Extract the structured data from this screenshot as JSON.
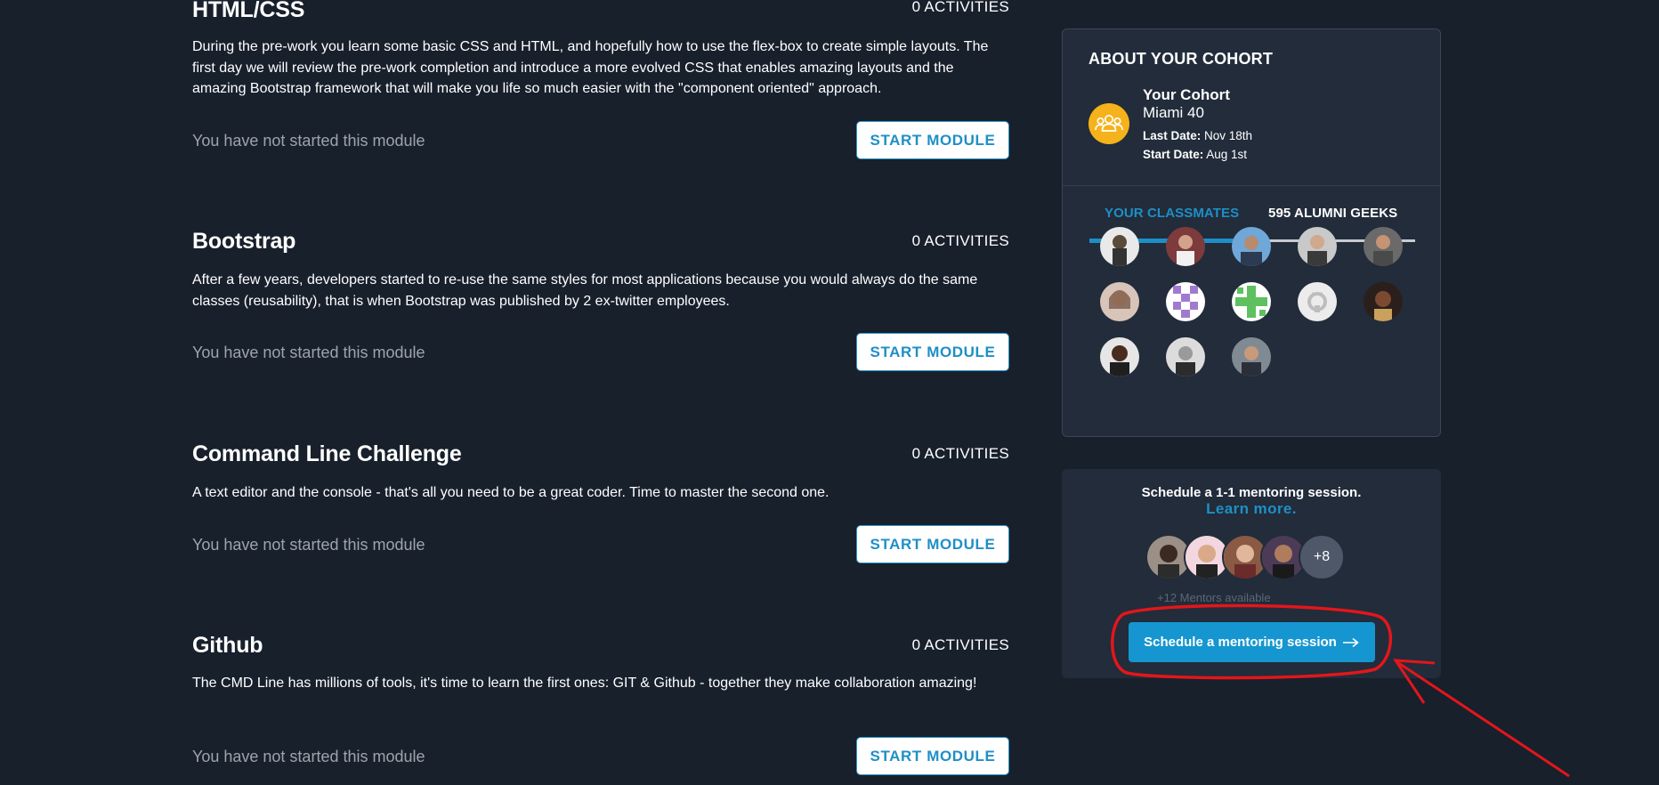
{
  "modules": [
    {
      "title": "HTML/CSS",
      "activities": "0 ACTIVITIES",
      "description": "During the pre-work you learn some basic CSS and HTML, and hopefully how to use the flex-box to create simple layouts. The first day we will review the pre-work completion and introduce a more evolved CSS that enables amazing layouts and the amazing Bootstrap framework that will make you life so much easier with the \"component oriented\" approach.",
      "status": "You have not started this module",
      "button": "START MODULE"
    },
    {
      "title": "Bootstrap",
      "activities": "0 ACTIVITIES",
      "description": "After a few years, developers started to re-use the same styles for most applications because you would always do the same classes (reusability), that is when Bootstrap was published by 2 ex-twitter employees.",
      "status": "You have not started this module",
      "button": "START MODULE"
    },
    {
      "title": "Command Line Challenge",
      "activities": "0 ACTIVITIES",
      "description": "A text editor and the console - that's all you need to be a great coder. Time to master the second one.",
      "status": "You have not started this module",
      "button": "START MODULE"
    },
    {
      "title": "Github",
      "activities": "0 ACTIVITIES",
      "description": "The CMD Line has millions of tools, it's time to learn the first ones: GIT & Github - together they make collaboration amazing!",
      "status": "You have not started this module",
      "button": "START MODULE"
    }
  ],
  "cohort": {
    "heading": "ABOUT YOUR COHORT",
    "label": "Your Cohort",
    "name": "Miami 40",
    "last_date_label": "Last Date:",
    "last_date": "Nov 18th",
    "start_date_label": "Start Date:",
    "start_date": "Aug 1st",
    "icon": "users-group-icon",
    "tabs": [
      {
        "label": "YOUR CLASSMATES",
        "active": true
      },
      {
        "label": "595 ALUMNI GEEKS",
        "active": false
      }
    ],
    "classmates_count": 13
  },
  "mentoring": {
    "prompt": "Schedule a 1-1 mentoring session.",
    "learn_more": "Learn more.",
    "more_count": "+8",
    "available": "+12 Mentors available",
    "button": "Schedule a mentoring session",
    "button_icon": "arrow-right-icon"
  },
  "colors": {
    "background": "#18202c",
    "card": "#222c3a",
    "accent": "#1e8fc6",
    "cohort_icon": "#f5b21a",
    "annotation": "#e3161b"
  }
}
